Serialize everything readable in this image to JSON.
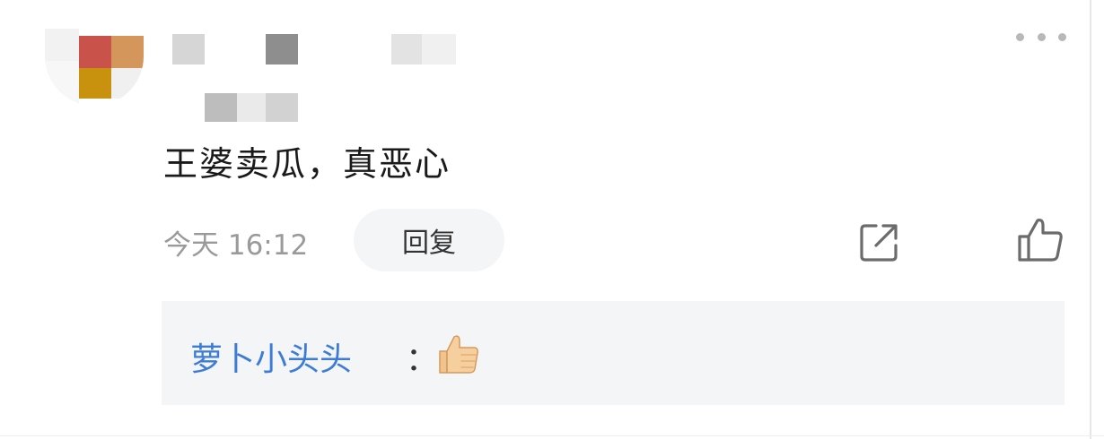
{
  "comment": {
    "text": "王婆卖瓜，真恶心",
    "timestamp": "今天 16:12",
    "reply_label": "回复"
  },
  "reply": {
    "author": "萝卜小头头",
    "separator": "：",
    "emoji": "thumbs-up-emoji"
  },
  "icons": {
    "more": "more-dots-icon",
    "share": "share-icon",
    "like": "thumbs-up-icon"
  },
  "colors": {
    "accent_blue": "#3d7cd6",
    "muted_gray": "#9a9a9a",
    "reply_bg": "#f4f5f7"
  }
}
